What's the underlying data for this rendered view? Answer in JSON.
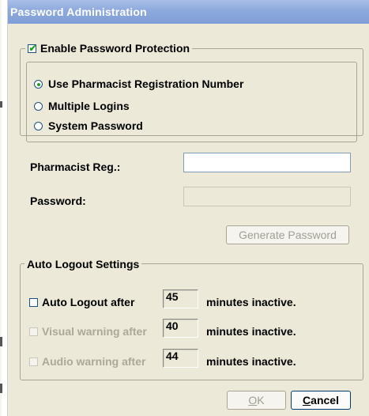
{
  "window": {
    "title": "Password Administration"
  },
  "protection": {
    "label": "Enable Password Protection",
    "checked": true,
    "options": [
      {
        "label": "Use Pharmacist Registration Number",
        "selected": true
      },
      {
        "label": "Multiple Logins",
        "selected": false
      },
      {
        "label": "System Password",
        "selected": false
      }
    ]
  },
  "fields": {
    "pharmacist_reg_label": "Pharmacist Reg.:",
    "pharmacist_reg_value": "",
    "password_label": "Password:",
    "password_value": ""
  },
  "generate_button": {
    "label": "Generate Password",
    "enabled": false
  },
  "auto_logout": {
    "title": "Auto Logout Settings",
    "rows": [
      {
        "label": "Auto Logout after",
        "value": "45",
        "suffix": "minutes inactive.",
        "checked": false,
        "enabled": true
      },
      {
        "label": "Visual warning after",
        "value": "40",
        "suffix": "minutes inactive.",
        "checked": false,
        "enabled": false
      },
      {
        "label": "Audio warning after",
        "value": "44",
        "suffix": "minutes inactive.",
        "checked": false,
        "enabled": false
      }
    ]
  },
  "footer": {
    "ok_mnemonic": "O",
    "ok_rest": "K",
    "cancel_mnemonic": "C",
    "cancel_rest": "ancel"
  },
  "colors": {
    "dialog_bg": "#ece9d8",
    "title_gradient": "#8da9dc",
    "check_accent": "#21a121",
    "disabled_text": "#aca899"
  }
}
